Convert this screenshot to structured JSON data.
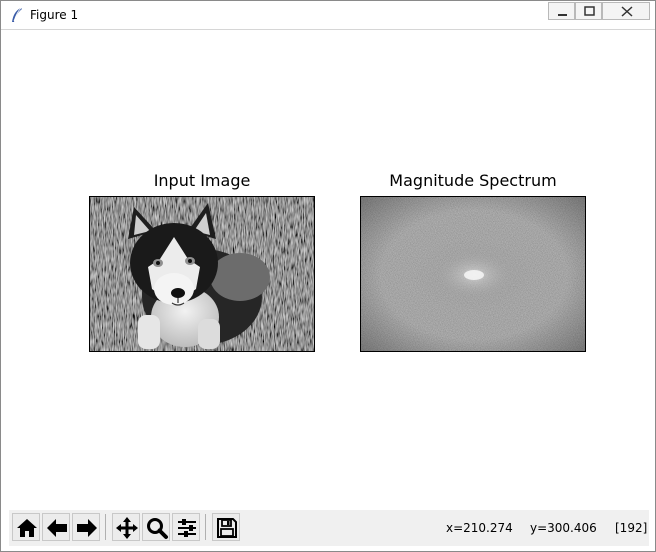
{
  "window": {
    "title": "Figure 1",
    "controls": [
      "minimize-icon",
      "maximize-icon",
      "close-icon"
    ]
  },
  "figure": {
    "axes": [
      {
        "title": "Input Image",
        "content": "grayscale-photo-husky-puppy-icon"
      },
      {
        "title": "Magnitude Spectrum",
        "content": "fft-magnitude-spectrum-icon"
      }
    ]
  },
  "toolbar": {
    "buttons": [
      "home-icon",
      "back-arrow-icon",
      "forward-arrow-icon",
      "pan-icon",
      "zoom-icon",
      "subplots-configure-icon",
      "save-icon"
    ]
  },
  "status": {
    "x": "x=210.274",
    "y": "y=300.406",
    "value": "[192]"
  },
  "colors": {
    "toolbar_bg": "#f0f0f0",
    "window_bg": "#ffffff",
    "spectrum_bg": "#8a8a8a"
  }
}
